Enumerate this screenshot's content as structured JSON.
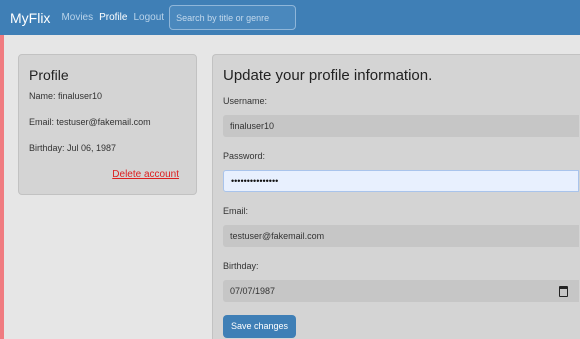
{
  "navbar": {
    "brand": "MyFlix",
    "links": [
      "Movies",
      "Profile",
      "Logout"
    ],
    "active_link": "Profile",
    "search_placeholder": "Search by title or genre"
  },
  "profile": {
    "title": "Profile",
    "name_line": "Name: finaluser10",
    "email_line": "Email: testuser@fakemail.com",
    "birthday_line": "Birthday: Jul 06, 1987",
    "delete_label": "Delete account"
  },
  "update_form": {
    "title": "Update your profile information.",
    "username_label": "Username:",
    "username_value": "finaluser10",
    "password_label": "Password:",
    "password_value": "•••••••••••••••",
    "email_label": "Email:",
    "email_value": "testuser@fakemail.com",
    "birthday_label": "Birthday:",
    "birthday_value": "07/07/1987",
    "save_label": "Save changes"
  },
  "colors": {
    "navbar": "#3f7fb6",
    "accent_strip": "#f07b80",
    "delete_link": "#dd1f1f",
    "button": "#3f7fb6"
  }
}
